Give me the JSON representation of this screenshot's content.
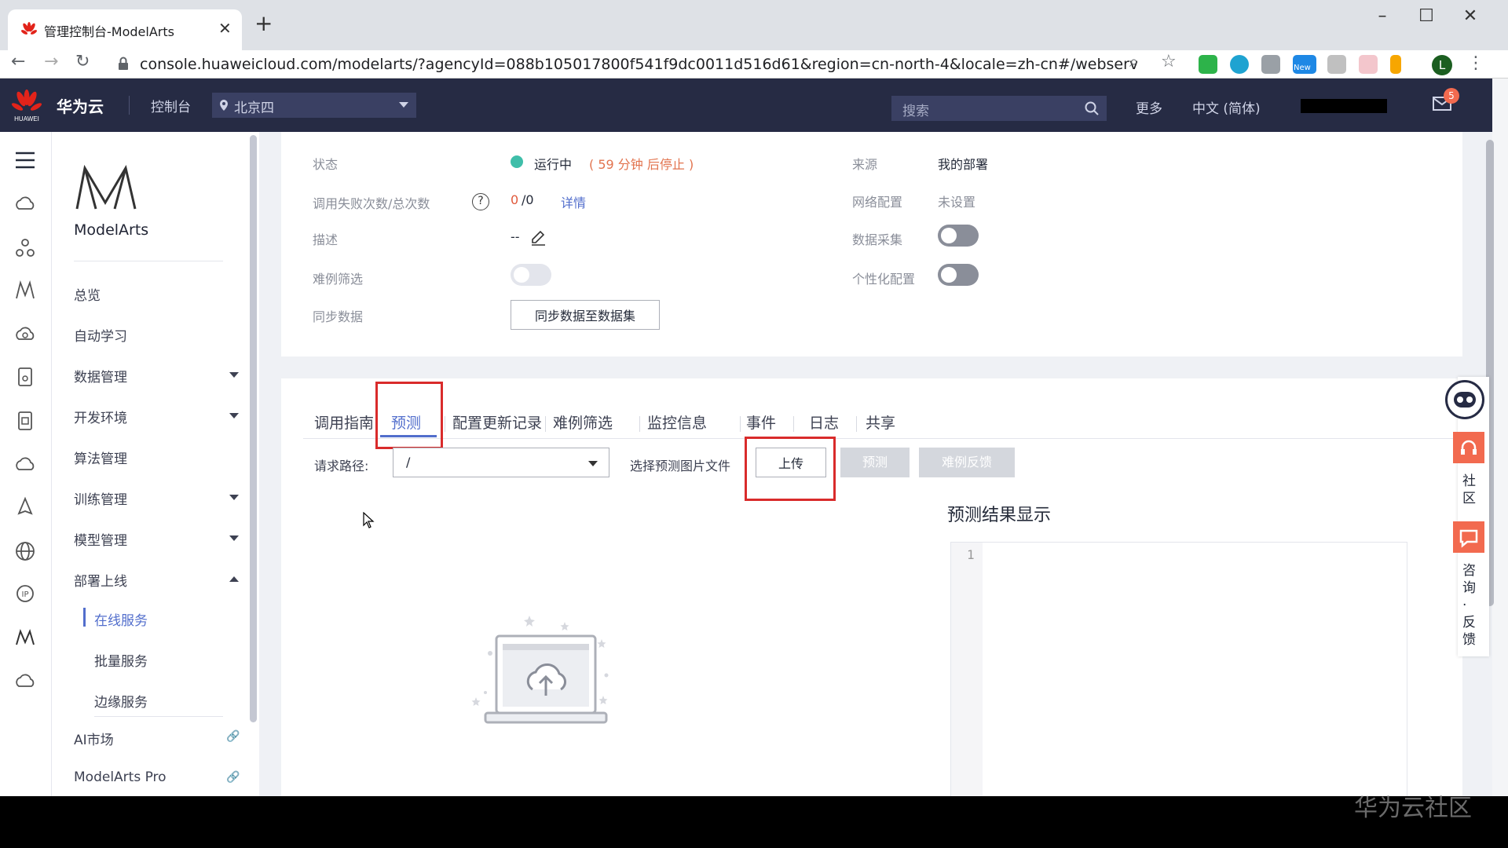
{
  "browser": {
    "tab_title": "管理控制台-ModelArts",
    "url": "console.huaweicloud.com/modelarts/?agencyId=088b105017800f541f9dc0011d516d61&region=cn-north-4&locale=zh-cn#/webservice/detail/re...",
    "profile_initial": "L",
    "ext_new_label": "New"
  },
  "header": {
    "brand": "华为云",
    "console": "控制台",
    "region": "北京四",
    "search_placeholder": "搜索",
    "more": "更多",
    "language": "中文 (简体)",
    "notification_count": "5",
    "logo_text": "HUAWEI"
  },
  "sidenav": {
    "product": "ModelArts",
    "items": {
      "overview": "总览",
      "auto_learning": "自动学习",
      "data_mgmt": "数据管理",
      "dev_env": "开发环境",
      "algo_mgmt": "算法管理",
      "train_mgmt": "训练管理",
      "model_mgmt": "模型管理",
      "deploy": "部署上线",
      "online_service": "在线服务",
      "batch_service": "批量服务",
      "edge_service": "边缘服务",
      "ai_market": "AI市场",
      "modelarts_pro": "ModelArts Pro"
    }
  },
  "details": {
    "status_label": "状态",
    "status_value": "运行中",
    "status_note": "( 59 分钟 后停止 )",
    "fail_label": "调用失败次数/总次数",
    "fail_count": "0",
    "total_count": "/0",
    "detail_link": "详情",
    "desc_label": "描述",
    "desc_value": "--",
    "hard_label": "难例筛选",
    "sync_label": "同步数据",
    "sync_button": "同步数据至数据集",
    "source_label": "来源",
    "source_value": "我的部署",
    "network_label": "网络配置",
    "network_value": "未设置",
    "collect_label": "数据采集",
    "personal_label": "个性化配置",
    "toggles": {
      "hard_example": false,
      "data_collect": false,
      "personal": false
    }
  },
  "tabs": [
    "调用指南",
    "预测",
    "配置更新记录",
    "难例筛选",
    "监控信息",
    "事件",
    "日志",
    "共享"
  ],
  "predict": {
    "path_label": "请求路径:",
    "path_value": "/",
    "file_label": "选择预测图片文件",
    "upload_button": "上传",
    "predict_button": "预测",
    "feedback_button": "难例反馈",
    "result_title": "预测结果显示",
    "line_number": "1"
  },
  "float": {
    "community": "社区",
    "consult": "咨询·反馈"
  },
  "watermark": "华为云社区",
  "colors": {
    "header_bg": "#262b44",
    "accent": "#526ecc",
    "running": "#3fbea9",
    "warning": "#e2734e",
    "highlight_box": "#d92b2b"
  }
}
